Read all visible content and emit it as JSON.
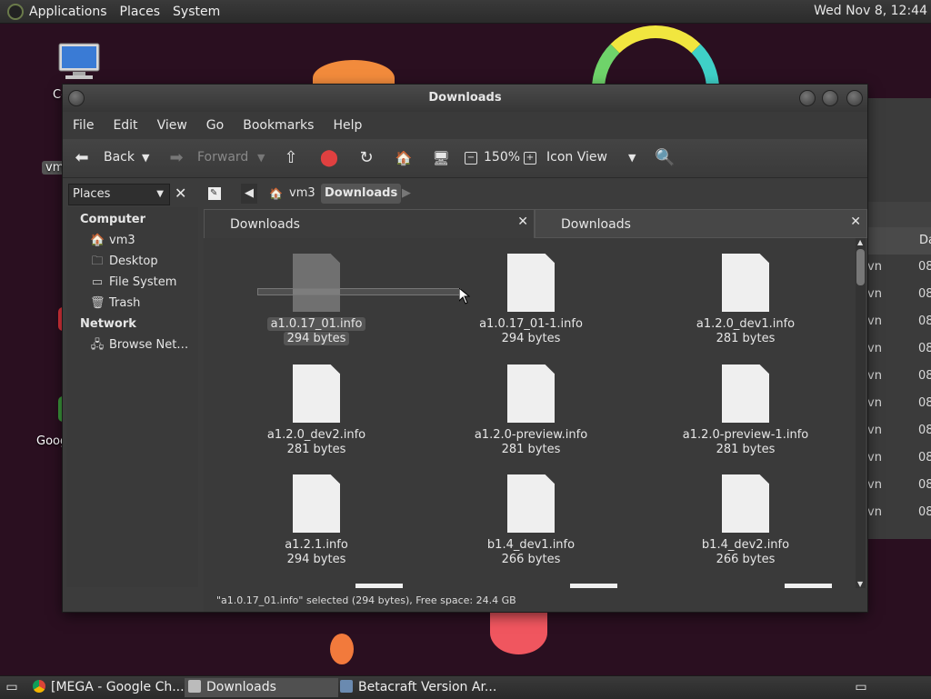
{
  "top_panel": {
    "menus": [
      "Applications",
      "Places",
      "System"
    ],
    "clock": "Wed Nov 8, 12:44"
  },
  "desktop": {
    "icons": [
      "Co",
      "vm",
      "Goog"
    ]
  },
  "window": {
    "title": "Downloads",
    "menubar": [
      "File",
      "Edit",
      "View",
      "Go",
      "Bookmarks",
      "Help"
    ],
    "toolbar": {
      "back": "Back",
      "forward": "Forward",
      "zoom": "150%",
      "view_mode": "Icon View"
    },
    "sidebar_select": "Places",
    "breadcrumb": [
      "vm3",
      "Downloads"
    ],
    "sidebar": {
      "computer_header": "Computer",
      "computer_items": [
        "vm3",
        "Desktop",
        "File System",
        "Trash"
      ],
      "network_header": "Network",
      "network_items": [
        "Browse Net…"
      ]
    },
    "tabs": [
      "Downloads",
      "Downloads"
    ],
    "files": [
      {
        "name": "a1.0.17_01.info",
        "size": "294 bytes"
      },
      {
        "name": "a1.0.17_01-1.info",
        "size": "294 bytes"
      },
      {
        "name": "a1.2.0_dev1.info",
        "size": "281 bytes"
      },
      {
        "name": "a1.2.0_dev2.info",
        "size": "281 bytes"
      },
      {
        "name": "a1.2.0-preview.info",
        "size": "281 bytes"
      },
      {
        "name": "a1.2.0-preview-1.info",
        "size": "281 bytes"
      },
      {
        "name": "a1.2.1.info",
        "size": "294 bytes"
      },
      {
        "name": "b1.4_dev1.info",
        "size": "266 bytes"
      },
      {
        "name": "b1.4_dev2.info",
        "size": "266 bytes"
      }
    ],
    "status": "\"a1.0.17_01.info\" selected (294 bytes), Free space: 24.4 GB"
  },
  "back_window": {
    "header": "Da",
    "rows": [
      "vn",
      "vn",
      "vn",
      "vn",
      "vn",
      "vn",
      "vn",
      "vn",
      "vn",
      "vn"
    ],
    "rows_right": [
      "08",
      "08",
      "08",
      "08",
      "08",
      "08",
      "08",
      "08",
      "08",
      "08"
    ]
  },
  "taskbar": {
    "tasks": [
      "[MEGA - Google Ch...",
      "Downloads",
      "Betacraft Version Ar..."
    ]
  }
}
